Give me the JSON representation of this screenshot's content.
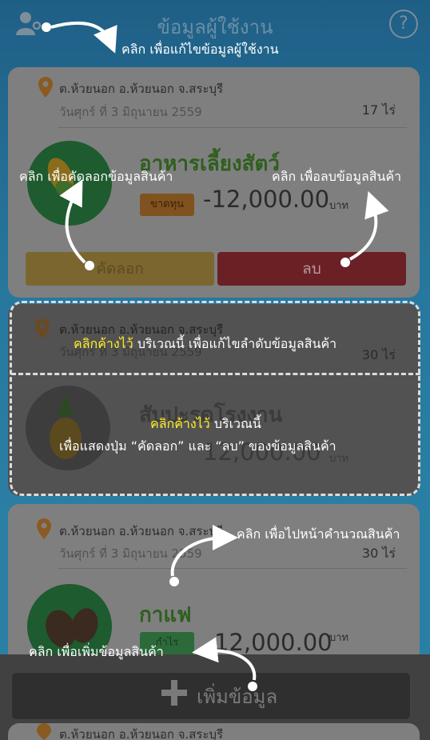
{
  "header": {
    "title": "ข้อมูลผู้ใช้งาน",
    "user_icon": "user-settings-icon",
    "help_icon_label": "?"
  },
  "cards": [
    {
      "location": "ต.ห้วยนอก อ.ห้วยนอก จ.สระบุรี",
      "date": "วันศุกร์ ที่ 3 มิถุนายน 2559",
      "area": "17 ไร่",
      "name": "อาหารเลี้ยงสัตว์",
      "status": "ขาดทุน",
      "amount": "-12,000.00",
      "unit": "บาท",
      "copy_label": "คัดลอก",
      "delete_label": "ลบ"
    },
    {
      "location": "ต.ห้วยนอก อ.ห้วยนอก จ.สระบุรี",
      "date": "วันศุกร์ ที่ 3 มิถุนายน 2559",
      "area": "30 ไร่",
      "name": "สับปะรดโรงงาน",
      "amount": "12,000.00",
      "unit": "บาท"
    },
    {
      "location": "ต.ห้วยนอก อ.ห้วยนอก จ.สระบุรี",
      "date": "วันศุกร์ ที่ 3 มิถุนายน 2559",
      "area": "30 ไร่",
      "name": "กาแฟ",
      "status": "กำไร",
      "amount": "12,000.00",
      "unit": "บาท"
    },
    {
      "location": "ต.ห้วยนอก อ.ห้วยนอก จ.สระบุรี"
    }
  ],
  "add_button": {
    "label": "เพิ่มข้อมูล"
  },
  "annotations": {
    "edit_user": "คลิก เพื่อแก้ไขข้อมูลผู้ใช้งาน",
    "copy_item": "คลิก เพื่อคัดลอกข้อมูลสินค้า",
    "delete_item": "คลิก เพื่อลบข้อมูลสินค้า",
    "reorder_prefix": "คลิกค้างไว้",
    "reorder_text": " บริเวณนี้ เพื่อแก้ไขลำดับข้อมูลสินค้า",
    "show_buttons_prefix": "คลิกค้างไว้",
    "show_buttons_text": " บริเวณนี้",
    "show_buttons_line2": "เพื่อแสดงปุ่ม “คัดลอก” และ “ลบ” ของข้อมูลสินค้า",
    "goto_calc": "คลิก เพื่อไปหน้าคำนวณสินค้า",
    "add_item": "คลิก เพื่อเพิ่มข้อมูลสินค้า"
  },
  "colors": {
    "highlight": "#ffee2a",
    "card_dim": "#7f7f7f",
    "copy_button": "#7b6630",
    "delete_button": "#6b2025"
  }
}
